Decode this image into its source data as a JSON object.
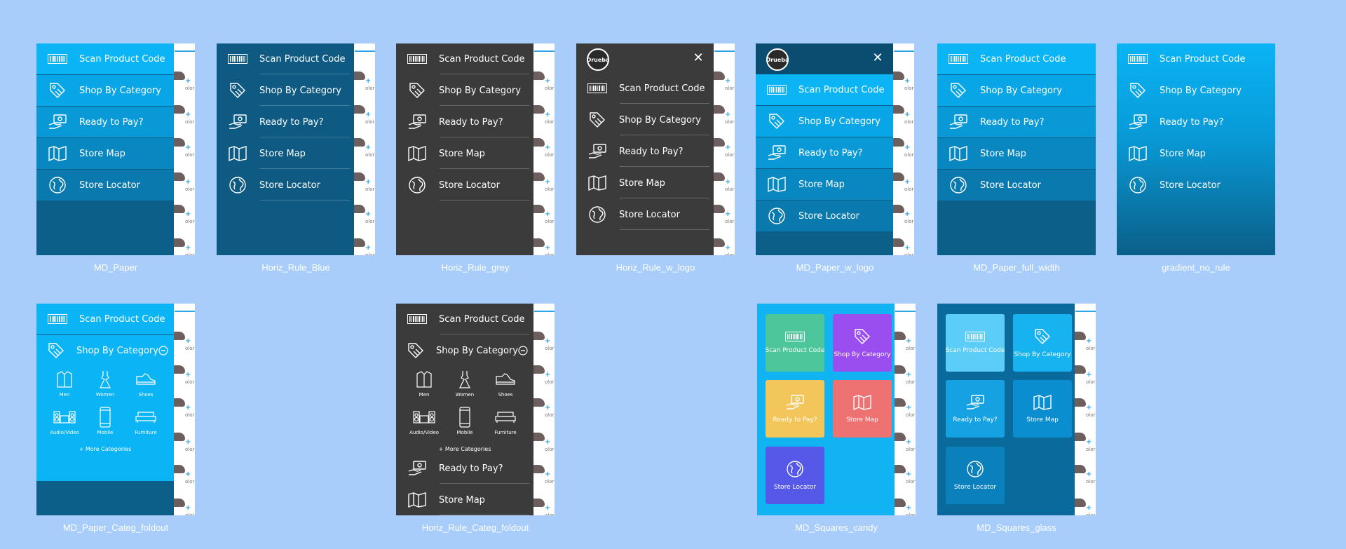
{
  "menu_labels": {
    "scan": "Scan Product Code",
    "shop": "Shop By Category",
    "pay": "Ready to Pay?",
    "map": "Store Map",
    "locator": "Store Locator"
  },
  "background": {
    "color_label": "olor"
  },
  "logo_text": "Drueba",
  "subcategories": [
    "Men",
    "Women",
    "Shoes",
    "Audio/Video",
    "Mobile",
    "Furniture"
  ],
  "more_categories": "+ More Categories",
  "variants": [
    {
      "name": "MD_Paper",
      "style": "paper"
    },
    {
      "name": "Horiz_Rule_Blue",
      "style": "rule-blue"
    },
    {
      "name": "Horiz_Rule_grey",
      "style": "rule-grey"
    },
    {
      "name": "Horiz_Rule_w_logo",
      "style": "rule-logo"
    },
    {
      "name": "MD_Paper_w_logo",
      "style": "paper-logo"
    },
    {
      "name": "MD_Paper_full_width",
      "style": "paper-full"
    },
    {
      "name": "gradient_no_rule",
      "style": "gradient"
    },
    {
      "name": "MD_Paper_Categ_foldout",
      "style": "paper-foldout"
    },
    {
      "name": "Horiz_Rule_Categ_foldout",
      "style": "grey-foldout"
    },
    {
      "name": "MD_Squares_candy",
      "style": "squares-candy"
    },
    {
      "name": "MD_Squares_glass",
      "style": "squares-glass"
    }
  ],
  "colors": {
    "page_bg": "#a8cdfb",
    "paper_1": "#0ab4f5",
    "paper_2": "#08a6e6",
    "paper_3": "#0899d6",
    "paper_4": "#0987c1",
    "paper_5": "#0a79ad",
    "paper_base": "#0b5f88",
    "rule_blue": "#0e5a82",
    "grey": "#3b3b3b",
    "candy_green": "#4cc69a",
    "candy_purple": "#9b4ef0",
    "candy_yellow": "#f2c65a",
    "candy_red": "#ef7272",
    "candy_indigo": "#5659e8",
    "accent": "#2ea3e6"
  }
}
